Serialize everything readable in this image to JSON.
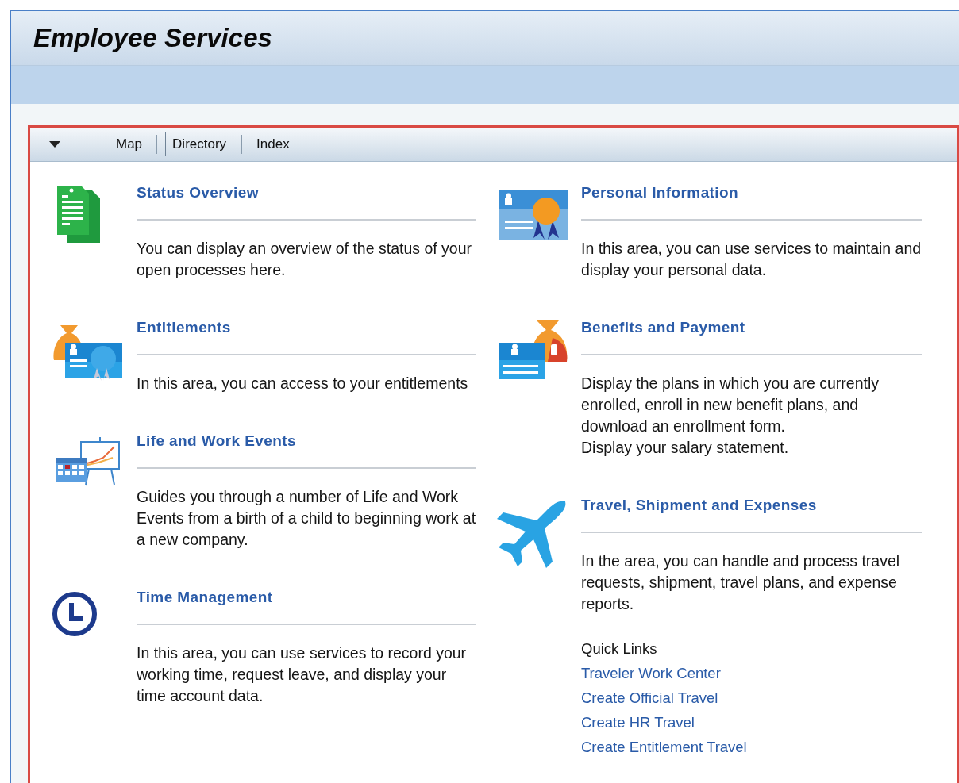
{
  "page_title": "Employee Services",
  "toolbar": {
    "tabs": [
      {
        "label": "Map",
        "selected": false
      },
      {
        "label": "Directory",
        "selected": true
      },
      {
        "label": "Index",
        "selected": false
      }
    ]
  },
  "columns": [
    {
      "items": [
        {
          "kind": "document",
          "title": "Status Overview",
          "description": [
            "You can display an overview of the status of your open processes here."
          ]
        },
        {
          "kind": "card-bag",
          "title": "Entitlements",
          "description": [
            "In this area, you can access to your entitlements"
          ]
        },
        {
          "kind": "calendar-chart",
          "title": "Life and Work Events",
          "description": [
            "Guides you through a number of Life and Work Events from a birth of a child to beginning work at a new company."
          ]
        },
        {
          "kind": "clock",
          "title": "Time Management",
          "description": [
            "In this area, you can use services to record your working time, request leave, and display your time account data."
          ]
        }
      ]
    },
    {
      "items": [
        {
          "kind": "card-ribbon",
          "title": "Personal Information",
          "description": [
            "In this area, you can use services to maintain and display your personal data."
          ]
        },
        {
          "kind": "card-money",
          "title": "Benefits and Payment",
          "description": [
            "Display the plans in which you are currently enrolled, enroll in new benefit plans, and download an enrollment form.",
            "Display your salary statement."
          ]
        },
        {
          "kind": "plane",
          "title": "Travel, Shipment and Expenses",
          "description": [
            "In the area, you can handle and process travel requests, shipment, travel plans, and expense reports."
          ],
          "quick_links": {
            "label": "Quick Links",
            "links": [
              "Traveler Work Center",
              "Create Official Travel",
              "Create HR Travel",
              "Create Entitlement Travel"
            ]
          }
        }
      ]
    }
  ]
}
